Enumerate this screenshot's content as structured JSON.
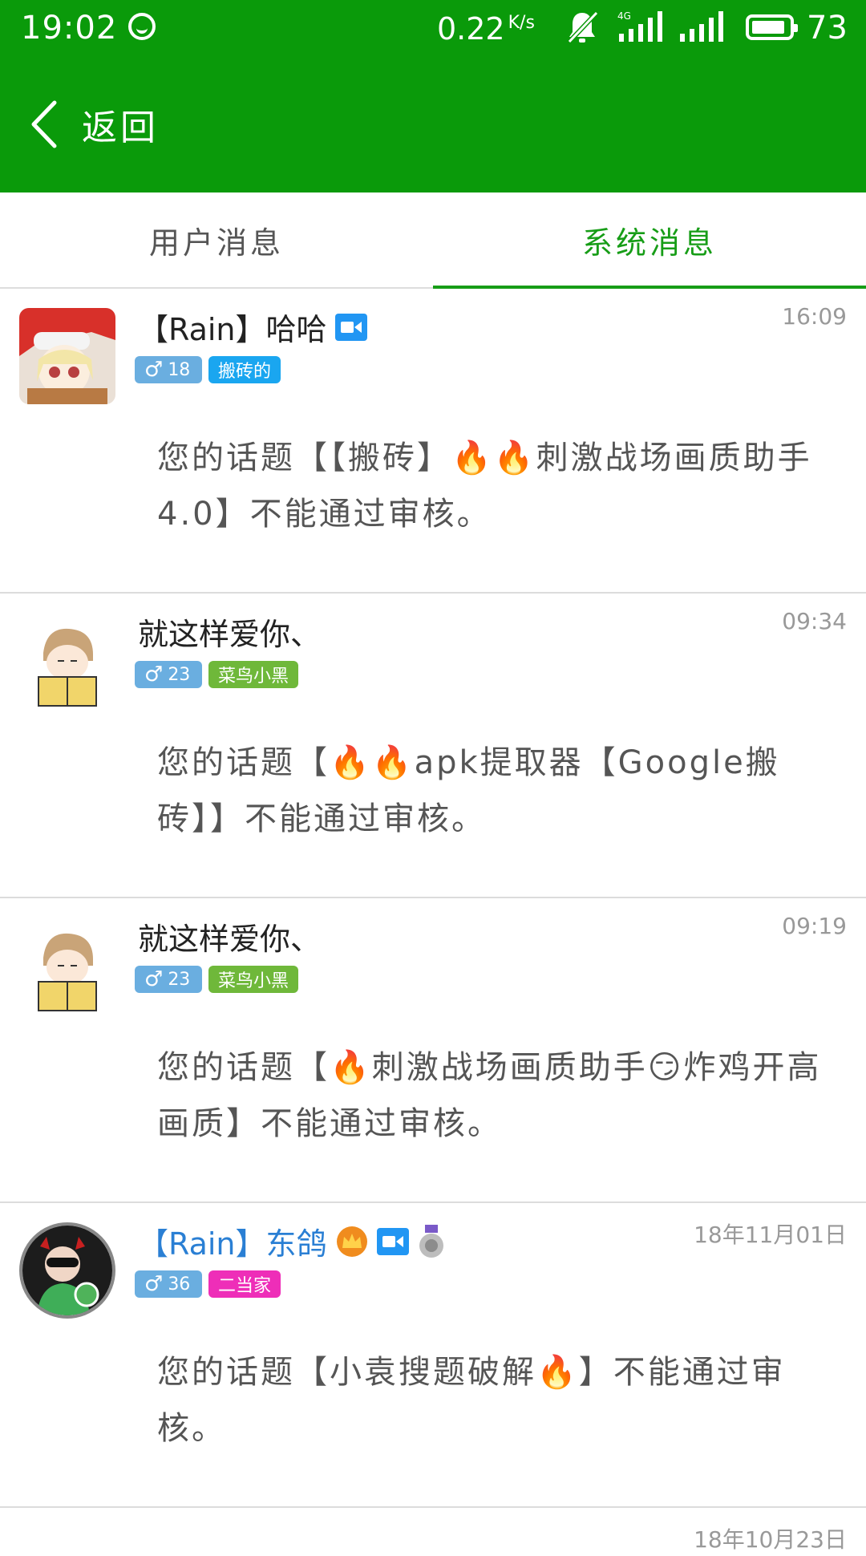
{
  "status_bar": {
    "time": "19:02",
    "net_speed": "0.22",
    "net_unit": "K/s",
    "net_type": "4G",
    "battery": "73"
  },
  "header": {
    "back_label": "返回"
  },
  "tabs": [
    {
      "label": "用户消息",
      "active": false
    },
    {
      "label": "系统消息",
      "active": true
    }
  ],
  "messages": [
    {
      "name": "【Rain】哈哈",
      "name_color": "#222222",
      "time": "16:09",
      "gender": "♂",
      "age": "18",
      "title_badge": "搬砖的",
      "title_color": "#1aa6f0",
      "text": "您的话题【【搬砖】🔥🔥刺激战场画质助手4.0】不能通过审核。",
      "icons": [
        "video-icon"
      ]
    },
    {
      "name": "就这样爱你、",
      "name_color": "#222222",
      "time": "09:34",
      "gender": "♂",
      "age": "23",
      "title_badge": "菜鸟小黑",
      "title_color": "#6fb83a",
      "text": "您的话题【🔥🔥apk提取器【Google搬砖】】不能通过审核。",
      "icons": []
    },
    {
      "name": "就这样爱你、",
      "name_color": "#222222",
      "time": "09:19",
      "gender": "♂",
      "age": "23",
      "title_badge": "菜鸟小黑",
      "title_color": "#6fb83a",
      "text": "您的话题【🔥刺激战场画质助手😏炸鸡开高画质】不能通过审核。",
      "icons": []
    },
    {
      "name": "【Rain】东鸽",
      "name_color": "#2a7fd4",
      "time": "18年11月01日",
      "gender": "♂",
      "age": "36",
      "title_badge": "二当家",
      "title_color": "#ee2eb8",
      "text": "您的话题【小袁搜题破解🔥】不能通过审核。",
      "icons": [
        "crown-icon",
        "video-icon",
        "medal-icon"
      ]
    }
  ],
  "next_partial": {
    "time": "18年10月23日"
  }
}
